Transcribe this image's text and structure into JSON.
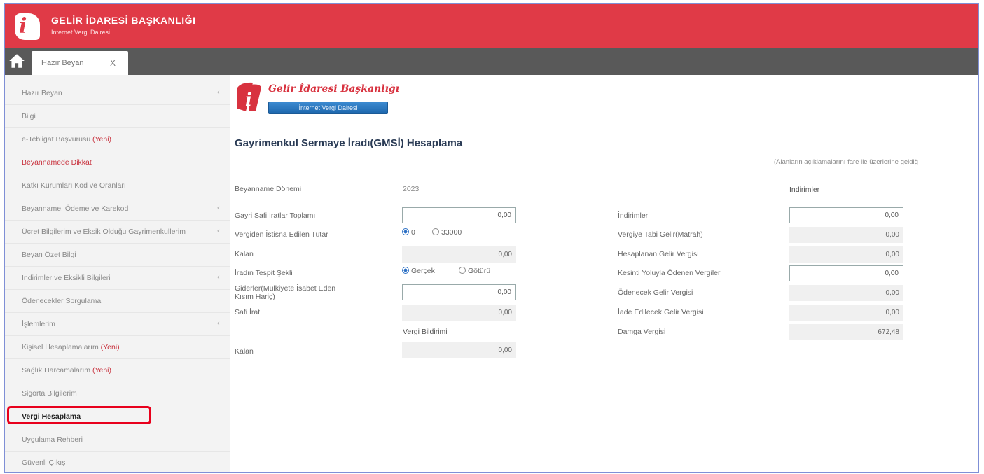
{
  "header": {
    "title": "GELİR İDARESİ BAŞKANLIĞI",
    "subtitle": "İnternet Vergi Dairesi"
  },
  "tabs": [
    {
      "label": "Hazır Beyan",
      "close": "X"
    }
  ],
  "sidebar": {
    "items": [
      {
        "label": "Hazır Beyan",
        "chevron": "‹"
      },
      {
        "label": "Bilgi"
      },
      {
        "label": "e-Tebligat Başvurusu ",
        "badge": "(Yeni)"
      },
      {
        "label": "Beyannamede Dikkat"
      },
      {
        "label": "Katkı Kurumları Kod ve Oranları"
      },
      {
        "label": "Beyanname, Ödeme ve Karekod",
        "chevron": "‹"
      },
      {
        "label": "Ücret Bilgilerim ve Eksik Olduğu Gayrimenkullerim",
        "chevron": "‹"
      },
      {
        "label": "Beyan Özet Bilgi"
      },
      {
        "label": "İndirimler ve Eksikli Bilgileri",
        "chevron": "‹"
      },
      {
        "label": "Ödenecekler Sorgulama"
      },
      {
        "label": "İşlemlerim",
        "chevron": "‹"
      },
      {
        "label": "Kişisel Hesaplamalarım ",
        "badge": "(Yeni)"
      },
      {
        "label": "Sağlık Harcamalarım ",
        "badge": "(Yeni)"
      },
      {
        "label": "Sigorta Bilgilerim"
      },
      {
        "label": "Vergi Hesaplama"
      },
      {
        "label": "Uygulama Rehberi"
      },
      {
        "label": "Güvenli Çıkış"
      }
    ]
  },
  "content": {
    "org_name": "Gelir İdaresi Başkanlığı",
    "ivd_button": "İnternet Vergi Dairesi",
    "page_title": "Gayrimenkul Sermaye İradı(GMSİ) Hesaplama",
    "notice": "(Alanların açıklamalarını fare ile üzerlerine geldiğ",
    "left": {
      "period_label": "Beyanname Dönemi",
      "period_value": "2023",
      "gross_label": "Gayri Safi İratlar Toplamı",
      "gross_value": "0,00",
      "exempt_label": "Vergiden İstisna Edilen Tutar",
      "exempt_opt1": "0",
      "exempt_opt2": "33000",
      "remaining1_label": "Kalan",
      "remaining1_value": "0,00",
      "method_label": "İradın Tespit Şekli",
      "method_opt1": "Gerçek",
      "method_opt2": "Götürü",
      "expense_label_1": "Giderler(Mülkiyete İsabet Eden",
      "expense_label_2": "Kısım Hariç)",
      "expense_value": "0,00",
      "net_label": "Safi İrat",
      "net_value": "0,00",
      "vergi_title": "Vergi Bildirimi",
      "remaining2_label": "Kalan",
      "remaining2_value": "0,00"
    },
    "right": {
      "section_title": "İndirimler",
      "deductions_label": "İndirimler",
      "deductions_value": "0,00",
      "taxable_label": "Vergiye Tabi Gelir(Matrah)",
      "taxable_value": "0,00",
      "calc_tax_label": "Hesaplanan Gelir Vergisi",
      "calc_tax_value": "0,00",
      "withheld_label": "Kesinti Yoluyla Ödenen Vergiler",
      "withheld_value": "0,00",
      "payable_label": "Ödenecek Gelir Vergisi",
      "payable_value": "0,00",
      "refund_label": "İade Edilecek Gelir Vergisi",
      "refund_value": "0,00",
      "stamp_label": "Damga Vergisi",
      "stamp_value": "672,48"
    }
  }
}
